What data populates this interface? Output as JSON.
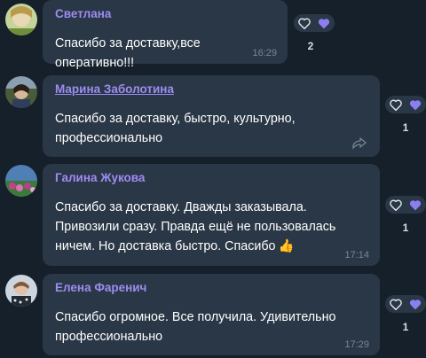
{
  "colors": {
    "background": "#15202b",
    "bubble": "#2a3746",
    "name": "#9d8cf2",
    "heart_filled": "#8b7ff0",
    "time": "#7a8794"
  },
  "messages": [
    {
      "author": "Светлана",
      "text": "Спасибо за доставку,все оперативно!!!",
      "time": "16:29",
      "reactions": {
        "count": "2",
        "icons": [
          "heart-outline-icon",
          "heart-filled-icon"
        ]
      }
    },
    {
      "author": "Марина Заболотина",
      "text": "Спасибо за доставку, быстро, культурно, профессионально",
      "time": "",
      "reactions": {
        "count": "1",
        "icons": [
          "heart-outline-icon",
          "heart-filled-icon"
        ]
      }
    },
    {
      "author": "Галина Жукова",
      "text": "Спасибо за доставку. Дважды заказывала. Привозили сразу. Правда ещё не пользовалась ничем. Но доставка быстро. Спасибо",
      "emoji": "👍",
      "time": "17:14",
      "reactions": {
        "count": "1",
        "icons": [
          "heart-outline-icon",
          "heart-filled-icon"
        ]
      }
    },
    {
      "author": "Елена Фаренич",
      "text": "Спасибо огромное. Все получила. Удивительно профессионально",
      "time": "17:29",
      "reactions": {
        "count": "1",
        "icons": [
          "heart-outline-icon",
          "heart-filled-icon"
        ]
      }
    }
  ]
}
